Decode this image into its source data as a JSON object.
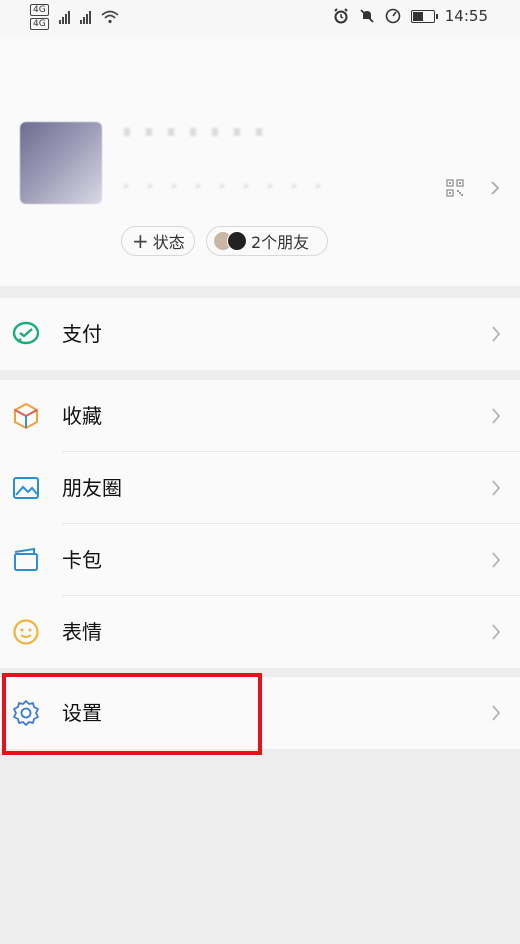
{
  "status_bar": {
    "sim1": "4G",
    "sim2": "4G",
    "time": "14:55",
    "battery_level": 0.55
  },
  "profile": {
    "status_chip_label": "状态",
    "friends_chip_label": "2个朋友"
  },
  "menu": {
    "pay": {
      "label": "支付",
      "icon": "wechat-pay-icon"
    },
    "favorites": {
      "label": "收藏",
      "icon": "favorites-cube-icon"
    },
    "moments": {
      "label": "朋友圈",
      "icon": "moments-photo-icon"
    },
    "cards": {
      "label": "卡包",
      "icon": "card-wallet-icon"
    },
    "stickers": {
      "label": "表情",
      "icon": "sticker-smiley-icon"
    },
    "settings": {
      "label": "设置",
      "icon": "gear-icon"
    }
  },
  "colors": {
    "pay_green": "#1aad7a",
    "favorites_orange": "#f0a23b",
    "moments_blue": "#2b8fd6",
    "cards_blue": "#2b8fd6",
    "stickers_yellow": "#f0b43a",
    "settings_blue": "#3a7bd5",
    "highlight_red": "#e4131b"
  }
}
